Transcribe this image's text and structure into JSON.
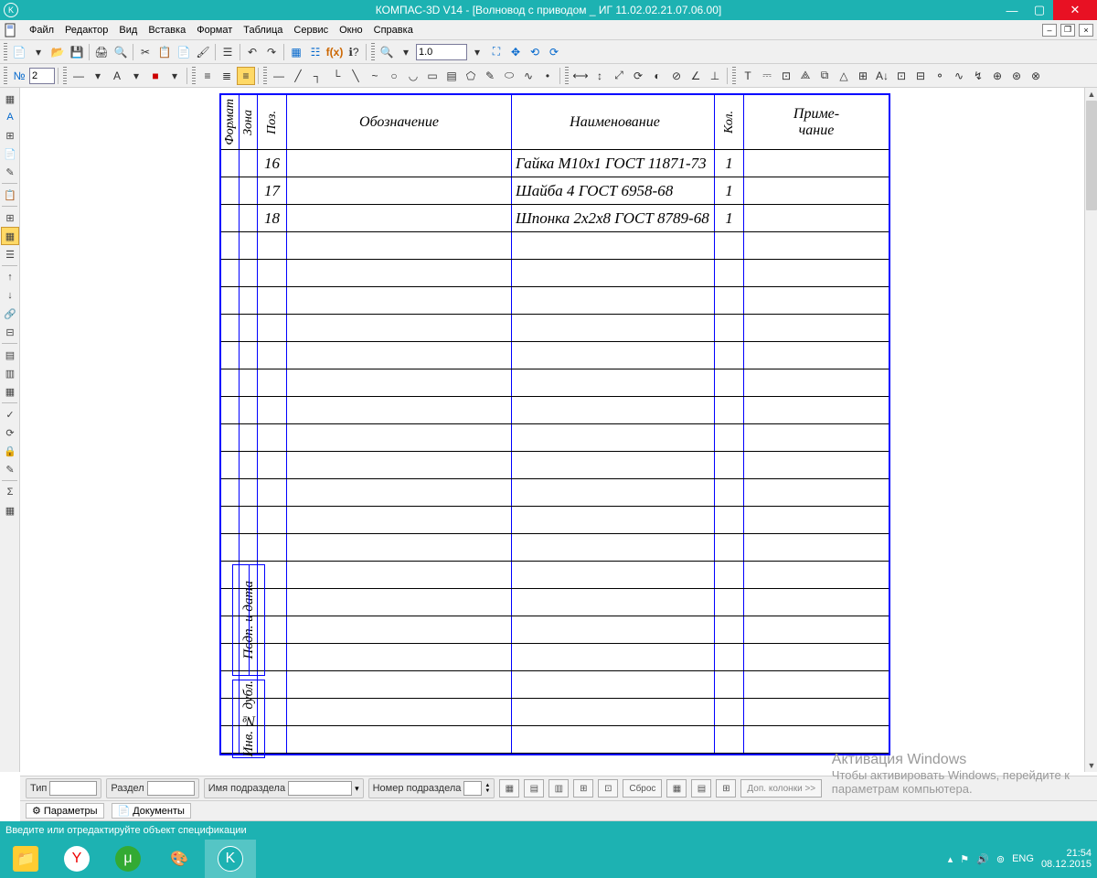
{
  "titlebar": {
    "text": "КОМПАС-3D V14 - [Волновод  с приводом _ ИГ 11.02.02.21.07.06.00]"
  },
  "menu": {
    "items": [
      "Файл",
      "Редактор",
      "Вид",
      "Вставка",
      "Формат",
      "Таблица",
      "Сервис",
      "Окно",
      "Справка"
    ]
  },
  "toolbar1": {
    "page_input": "2",
    "zoom_value": "1.0"
  },
  "spec": {
    "headers": {
      "format": "Формат",
      "zona": "Зона",
      "poz": "Поз.",
      "oboz": "Обозначение",
      "naim": "Наименование",
      "kol": "Кол.",
      "prim1": "Приме-",
      "prim2": "чание"
    },
    "rows": [
      {
        "poz": "16",
        "oboz": "",
        "naim": "Гайка М10х1 ГОСТ 11871-73",
        "kol": "1",
        "prim": ""
      },
      {
        "poz": "17",
        "oboz": "",
        "naim": "Шайба 4 ГОСТ 6958-68",
        "kol": "1",
        "prim": ""
      },
      {
        "poz": "18",
        "oboz": "",
        "naim": "Шпонка 2х2х8 ГОСТ 8789-68",
        "kol": "1",
        "prim": ""
      }
    ],
    "empty_rows": 19,
    "side1": "Подп. и дата",
    "side2": "Инв. № дубл."
  },
  "parambar": {
    "tip_label": "Тип",
    "tip_value": "",
    "razdel_label": "Раздел",
    "razdel_value": "",
    "imya_label": "Имя подраздела",
    "imya_value": "",
    "nomer_label": "Номер подраздела",
    "nomer_value": "",
    "sbros": "Сброс",
    "dop": "Доп. колонки  >>"
  },
  "tabs": {
    "parametry": "Параметры",
    "dokumenty": "Документы"
  },
  "status": {
    "text": "Введите или отредактируйте объект спецификации"
  },
  "watermark": {
    "line1": "Активация Windows",
    "line2": "Чтобы активировать Windows, перейдите к",
    "line3": "параметрам компьютера."
  },
  "tray": {
    "lang": "ENG",
    "time": "21:54",
    "date": "08.12.2015"
  }
}
